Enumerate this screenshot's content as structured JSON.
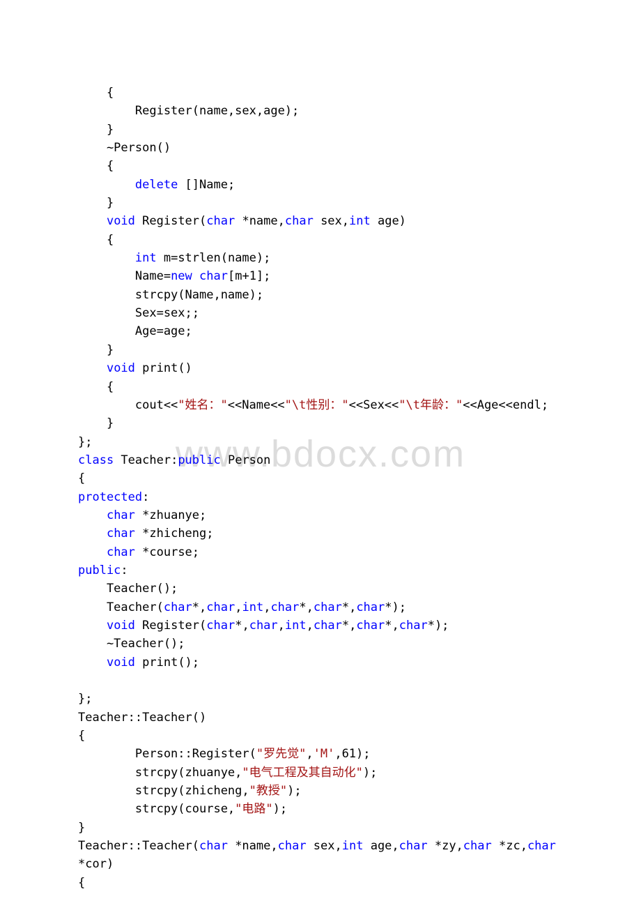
{
  "watermark": "www.bdocx.com",
  "code_tokens": [
    "    {\n",
    "        Register(name,sex,age);\n",
    "    }\n",
    "    ~Person()\n",
    "    {\n",
    "        ",
    {
      "c": "kw",
      "t": "delete"
    },
    " []Name;\n",
    "    }\n",
    "    ",
    {
      "c": "kw",
      "t": "void"
    },
    " Register(",
    {
      "c": "kw",
      "t": "char"
    },
    " *name,",
    {
      "c": "kw",
      "t": "char"
    },
    " sex,",
    {
      "c": "kw",
      "t": "int"
    },
    " age)\n",
    "    {\n",
    "        ",
    {
      "c": "kw",
      "t": "int"
    },
    " m=strlen(name);\n",
    "        Name=",
    {
      "c": "kw",
      "t": "new"
    },
    " ",
    {
      "c": "kw",
      "t": "char"
    },
    "[m+1];\n",
    "        strcpy(Name,name);\n",
    "        Sex=sex;;\n",
    "        Age=age;\n",
    "    }\n",
    "    ",
    {
      "c": "kw",
      "t": "void"
    },
    " print()\n",
    "    {\n",
    "        cout<<",
    {
      "c": "str",
      "t": "\"姓名：\""
    },
    "<<Name<<",
    {
      "c": "str",
      "t": "\"\\t性别：\""
    },
    "<<Sex<<",
    {
      "c": "str",
      "t": "\"\\t年龄：\""
    },
    "<<Age<<endl;\n",
    "    }\n",
    "};\n",
    {
      "c": "kw",
      "t": "class"
    },
    " Teacher:",
    {
      "c": "kw",
      "t": "public"
    },
    " Person\n",
    "{\n",
    {
      "c": "kw",
      "t": "protected"
    },
    ":\n",
    "    ",
    {
      "c": "kw",
      "t": "char"
    },
    " *zhuanye;\n",
    "    ",
    {
      "c": "kw",
      "t": "char"
    },
    " *zhicheng;\n",
    "    ",
    {
      "c": "kw",
      "t": "char"
    },
    " *course;\n",
    {
      "c": "kw",
      "t": "public"
    },
    ":\n",
    "    Teacher();\n",
    "    Teacher(",
    {
      "c": "kw",
      "t": "char"
    },
    "*,",
    {
      "c": "kw",
      "t": "char"
    },
    ",",
    {
      "c": "kw",
      "t": "int"
    },
    ",",
    {
      "c": "kw",
      "t": "char"
    },
    "*,",
    {
      "c": "kw",
      "t": "char"
    },
    "*,",
    {
      "c": "kw",
      "t": "char"
    },
    "*);\n",
    "    ",
    {
      "c": "kw",
      "t": "void"
    },
    " Register(",
    {
      "c": "kw",
      "t": "char"
    },
    "*,",
    {
      "c": "kw",
      "t": "char"
    },
    ",",
    {
      "c": "kw",
      "t": "int"
    },
    ",",
    {
      "c": "kw",
      "t": "char"
    },
    "*,",
    {
      "c": "kw",
      "t": "char"
    },
    "*,",
    {
      "c": "kw",
      "t": "char"
    },
    "*);\n",
    "    ~Teacher();\n",
    "    ",
    {
      "c": "kw",
      "t": "void"
    },
    " print();\n",
    "\n",
    "};\n",
    "Teacher::Teacher()\n",
    "{\n",
    "        Person::Register(",
    {
      "c": "str",
      "t": "\"罗先觉\""
    },
    ",",
    {
      "c": "chr",
      "t": "'M'"
    },
    ",61);\n",
    "        strcpy(zhuanye,",
    {
      "c": "str",
      "t": "\"电气工程及其自动化\""
    },
    ");\n",
    "        strcpy(zhicheng,",
    {
      "c": "str",
      "t": "\"教授\""
    },
    ");\n",
    "        strcpy(course,",
    {
      "c": "str",
      "t": "\"电路\""
    },
    ");\n",
    "}\n",
    "Teacher::Teacher(",
    {
      "c": "kw",
      "t": "char"
    },
    " *name,",
    {
      "c": "kw",
      "t": "char"
    },
    " sex,",
    {
      "c": "kw",
      "t": "int"
    },
    " age,",
    {
      "c": "kw",
      "t": "char"
    },
    " *zy,",
    {
      "c": "kw",
      "t": "char"
    },
    " *zc,",
    {
      "c": "kw",
      "t": "char"
    },
    " \n",
    "*cor)\n",
    "{\n"
  ]
}
